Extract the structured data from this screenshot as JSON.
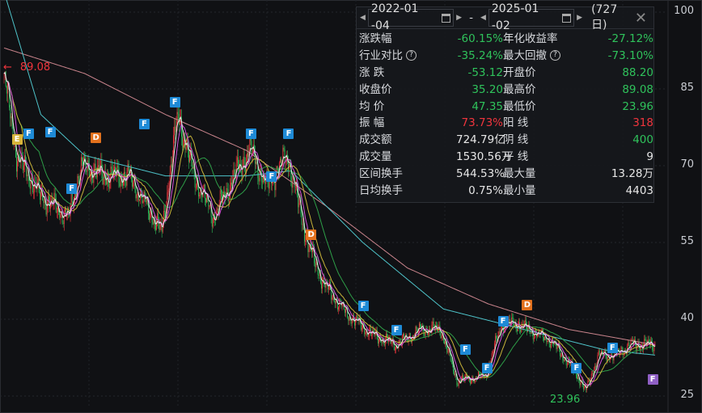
{
  "chart_data": {
    "type": "candlestick",
    "yticks": [
      100,
      85,
      70,
      55,
      40,
      25
    ],
    "ylim": [
      23,
      102
    ],
    "days": 727,
    "close_anchors": [
      [
        0,
        88
      ],
      [
        14,
        72
      ],
      [
        41,
        64
      ],
      [
        72,
        60
      ],
      [
        86,
        70
      ],
      [
        113,
        68
      ],
      [
        140,
        68
      ],
      [
        176,
        57
      ],
      [
        194,
        80
      ],
      [
        212,
        68
      ],
      [
        234,
        60
      ],
      [
        257,
        68
      ],
      [
        275,
        73
      ],
      [
        293,
        66
      ],
      [
        316,
        72
      ],
      [
        338,
        55
      ],
      [
        356,
        47
      ],
      [
        383,
        41
      ],
      [
        410,
        37
      ],
      [
        437,
        35
      ],
      [
        464,
        38
      ],
      [
        487,
        38
      ],
      [
        505,
        28
      ],
      [
        537,
        29
      ],
      [
        555,
        39
      ],
      [
        573,
        39
      ],
      [
        609,
        36
      ],
      [
        636,
        30
      ],
      [
        649,
        26
      ],
      [
        663,
        33
      ],
      [
        681,
        33
      ],
      [
        699,
        35
      ],
      [
        726,
        35
      ]
    ],
    "ma_long": [
      [
        0,
        93
      ],
      [
        90,
        88
      ],
      [
        180,
        80
      ],
      [
        270,
        73
      ],
      [
        360,
        62
      ],
      [
        450,
        50
      ],
      [
        540,
        43
      ],
      [
        630,
        38
      ],
      [
        726,
        35
      ]
    ],
    "ma_mid": [
      [
        0,
        104
      ],
      [
        41,
        80
      ],
      [
        90,
        72
      ],
      [
        180,
        68
      ],
      [
        270,
        68
      ],
      [
        320,
        69
      ],
      [
        400,
        55
      ],
      [
        490,
        42
      ],
      [
        580,
        38
      ],
      [
        670,
        34
      ],
      [
        726,
        33
      ]
    ],
    "max_label": "89.08",
    "min_label": "23.96",
    "markers": [
      {
        "t": "E",
        "i": 14,
        "p": 75.2,
        "c": "#d8b43a"
      },
      {
        "t": "F",
        "i": 27,
        "p": 76.3,
        "c": "#1e8ad6"
      },
      {
        "t": "F",
        "i": 51,
        "p": 76.6,
        "c": "#1e8ad6"
      },
      {
        "t": "F",
        "i": 75,
        "p": 65.6,
        "c": "#1e8ad6"
      },
      {
        "t": "D",
        "i": 102,
        "p": 75.5,
        "c": "#e2711d"
      },
      {
        "t": "F",
        "i": 156,
        "p": 78.2,
        "c": "#1e8ad6"
      },
      {
        "t": "F",
        "i": 190,
        "p": 82.5,
        "c": "#1e8ad6"
      },
      {
        "t": "F",
        "i": 275,
        "p": 76.3,
        "c": "#1e8ad6"
      },
      {
        "t": "F",
        "i": 298,
        "p": 68,
        "c": "#1e8ad6"
      },
      {
        "t": "F",
        "i": 317,
        "p": 76.3,
        "c": "#1e8ad6"
      },
      {
        "t": "D",
        "i": 342,
        "p": 56.6,
        "c": "#e2711d"
      },
      {
        "t": "F",
        "i": 400,
        "p": 42.7,
        "c": "#1e8ad6"
      },
      {
        "t": "F",
        "i": 437,
        "p": 38,
        "c": "#1e8ad6"
      },
      {
        "t": "F",
        "i": 514,
        "p": 34.2,
        "c": "#1e8ad6"
      },
      {
        "t": "F",
        "i": 538,
        "p": 30.5,
        "c": "#1e8ad6"
      },
      {
        "t": "F",
        "i": 556,
        "p": 39.7,
        "c": "#1e8ad6"
      },
      {
        "t": "D",
        "i": 583,
        "p": 42.8,
        "c": "#e2711d"
      },
      {
        "t": "F",
        "i": 638,
        "p": 30.5,
        "c": "#1e8ad6"
      },
      {
        "t": "F",
        "i": 678,
        "p": 34.5,
        "c": "#1e8ad6"
      },
      {
        "t": "F",
        "i": 723,
        "p": 28.3,
        "c": "#8f5fc4"
      }
    ]
  },
  "panel": {
    "start_date": "2022-01 -04",
    "sep": "-",
    "end_date": "2025-01 -02",
    "days": "(727日)",
    "close": "✕",
    "rows": [
      [
        "涨跌幅",
        "-60.15%",
        "g",
        "年化收益率",
        "-27.12%",
        "g",
        false
      ],
      [
        "行业对比",
        "-35.24%",
        "g",
        "最大回撤",
        "-73.10%",
        "g",
        true
      ],
      [
        "涨  跌",
        "-53.12",
        "g",
        "开盘价",
        "88.20",
        "g",
        false
      ],
      [
        "收盘价",
        "35.20",
        "g",
        "最高价",
        "89.08",
        "g",
        false
      ],
      [
        "均  价",
        "47.35",
        "g",
        "最低价",
        "23.96",
        "g",
        false
      ],
      [
        "振  幅",
        "73.73%",
        "r",
        "阳  线",
        "318",
        "r",
        false
      ],
      [
        "成交额",
        "724.79亿",
        "w",
        "阴  线",
        "400",
        "g",
        false
      ],
      [
        "成交量",
        "1530.56万",
        "w",
        "平 线",
        "9",
        "w",
        false
      ],
      [
        "区间换手",
        "544.53%",
        "w",
        "最大量",
        "13.28万",
        "w",
        false
      ],
      [
        "日均换手",
        "0.75%",
        "w",
        "最小量",
        "4403",
        "w",
        false
      ]
    ]
  }
}
